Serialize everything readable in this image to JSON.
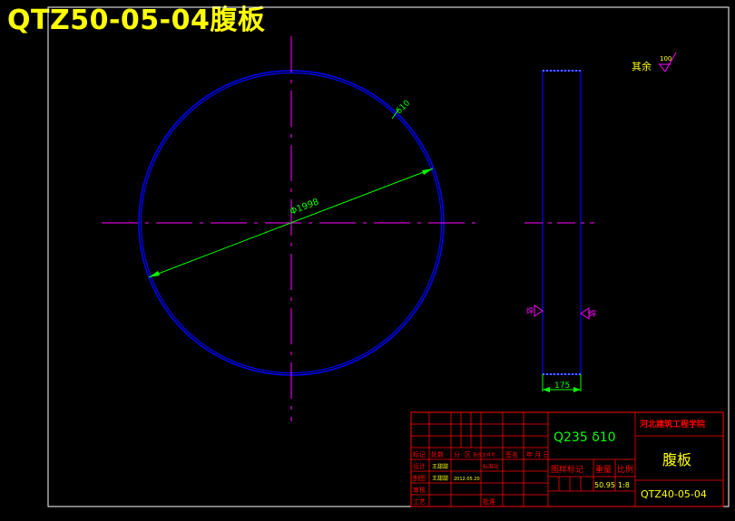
{
  "title": "QTZ50-05-04腹板",
  "colors": {
    "background": "#000000",
    "frame": "#ffffff",
    "outline": "#0000ff",
    "centerline": "#ff00ff",
    "dimension": "#00ff00",
    "title_text": "#ffff00",
    "tb_red": "#ff0000",
    "tb_yellow": "#ffff00",
    "tb_green": "#00ff00"
  },
  "drawing": {
    "thickness_label": "δ10",
    "diameter_label": "Φ1998",
    "width_label": "175",
    "roughness_note": "其余",
    "roughness_value": "100",
    "weld_left_label": "焊",
    "weld_right_label": "焊"
  },
  "title_block": {
    "material": "Q235 δ10",
    "school": "河北建筑工程学院",
    "part_name": "腹板",
    "part_code": "QTZ40-05-04",
    "header_labels": [
      "标记",
      "处数",
      "分",
      "区",
      "更改文件号",
      "签名",
      "年 月 日"
    ],
    "rows": [
      {
        "role": "设计",
        "name": "王甜甜",
        "extra": "标准化"
      },
      {
        "role": "制图",
        "name": "王甜甜",
        "extra": "2012.05.20"
      },
      {
        "role": "审核",
        "name": "",
        "extra": ""
      },
      {
        "role": "工艺",
        "name": "",
        "extra": "批准"
      }
    ],
    "stage_label": "图样标记",
    "weight_label": "重量",
    "scale_label": "比例",
    "weight_value": "50.95",
    "scale_value": "1:8"
  }
}
